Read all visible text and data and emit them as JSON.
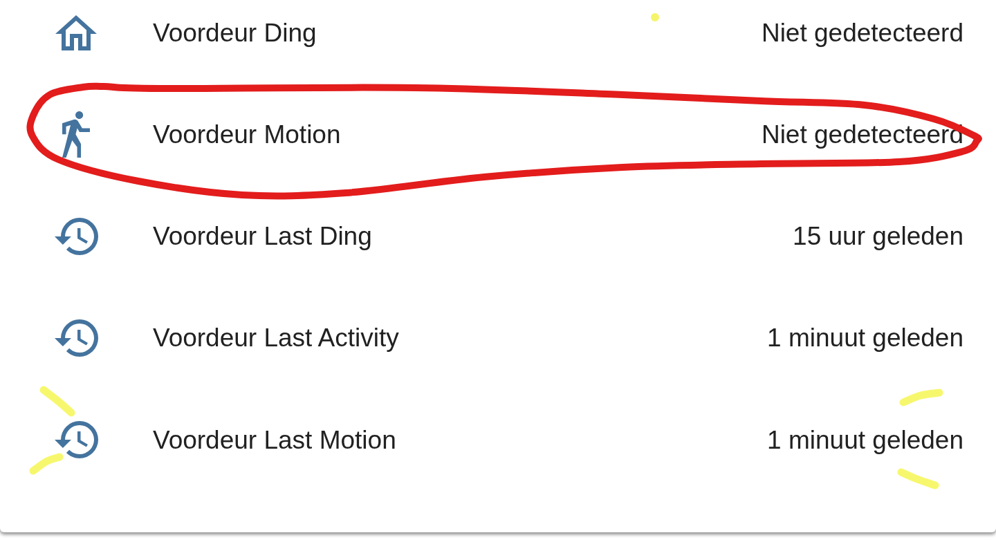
{
  "entities": [
    {
      "kind": "ding",
      "name": "Voordeur Ding",
      "state": "Niet gedetecteerd",
      "circled": false,
      "emphasis_marks": false
    },
    {
      "kind": "motion",
      "name": "Voordeur Motion",
      "state": "Niet gedetecteerd",
      "circled": true,
      "emphasis_marks": false
    },
    {
      "kind": "time",
      "name": "Voordeur Last Ding",
      "state": "15 uur geleden",
      "circled": false,
      "emphasis_marks": false
    },
    {
      "kind": "time",
      "name": "Voordeur Last Activity",
      "state": "1 minuut geleden",
      "circled": false,
      "emphasis_marks": false
    },
    {
      "kind": "time",
      "name": "Voordeur Last Motion",
      "state": "1 minuut geleden",
      "circled": false,
      "emphasis_marks": true
    }
  ],
  "annotations": {
    "stray_dot": true
  }
}
